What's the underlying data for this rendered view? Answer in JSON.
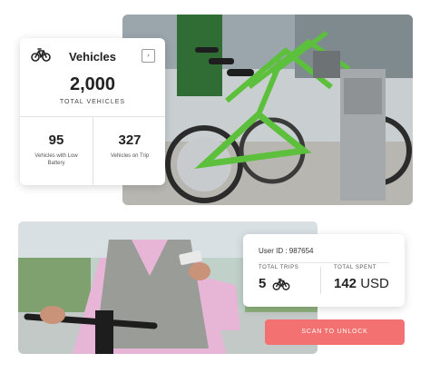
{
  "vehicles": {
    "title": "Vehicles",
    "arrow": "›",
    "total": "2,000",
    "total_label": "TOTAL VEHICLES",
    "stats": [
      {
        "value": "95",
        "label": "Vehicles with Low Battery"
      },
      {
        "value": "327",
        "label": "Vehicles on Trip"
      }
    ]
  },
  "user": {
    "id_label": "User ID :",
    "id_value": "987654",
    "total_trips_label": "TOTAL TRIPS",
    "total_trips": "5",
    "total_spent_label": "TOTAL SPENT",
    "total_spent_amount": "142",
    "total_spent_currency": "USD"
  },
  "scan_button": {
    "label": "SCAN TO UNLOCK"
  },
  "colors": {
    "accent": "#f47171",
    "bike_green": "#5cc03c"
  },
  "icons": {
    "vehicles": "bike-icon",
    "trips": "bike-icon",
    "arrow": "chevron-right-icon"
  }
}
